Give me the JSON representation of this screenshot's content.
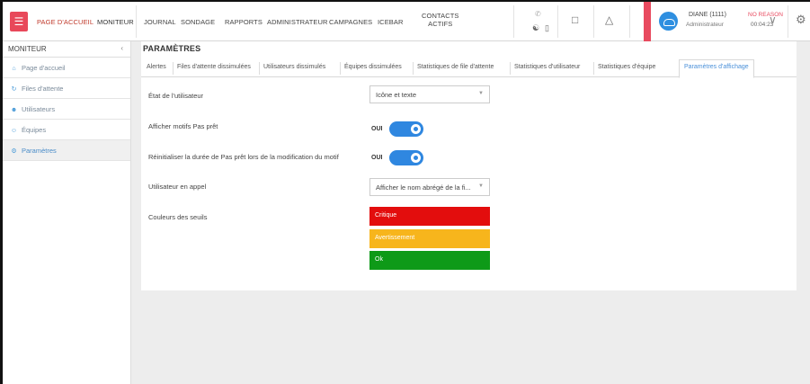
{
  "topbar": {
    "menu_icon": "hamburger-icon",
    "nav": [
      "PAGE D'ACCUEIL",
      "MONITEUR",
      "JOURNAL",
      "SONDAGE",
      "RAPPORTS",
      "ADMINISTRATEUR",
      "CAMPAGNES",
      "ICEBAR"
    ],
    "contacts_line1": "CONTACTS",
    "contacts_line2": "ACTIFS",
    "user": {
      "name": "DIANE (1111)",
      "role": "Administrateur",
      "reason": "NO REASON",
      "timer": "00:04:23"
    },
    "colors": {
      "accent": "#e84a5f",
      "avatar": "#2f8fe0"
    }
  },
  "sidebar": {
    "title": "MONITEUR",
    "items": [
      {
        "label": "Page d'accueil",
        "icon": "home-icon"
      },
      {
        "label": "Files d'attente",
        "icon": "queue-icon"
      },
      {
        "label": "Utilisateurs",
        "icon": "user-icon"
      },
      {
        "label": "Équipes",
        "icon": "team-icon"
      },
      {
        "label": "Paramètres",
        "icon": "gears-icon"
      }
    ]
  },
  "main": {
    "title": "PARAMÈTRES",
    "tabs": [
      "Alertes",
      "Files d'attente dissimulées",
      "Utilisateurs dissimulés",
      "Équipes dissimulées",
      "Statistiques de file d'attente",
      "Statistiques d'utilisateur",
      "Statistiques d'équipe",
      "Paramètres d'affichage"
    ],
    "settings": {
      "user_state_label": "État de l'utilisateur",
      "user_state_value": "Icône et texte",
      "show_not_ready_label": "Afficher motifs Pas prêt",
      "show_not_ready_value": "OUI",
      "reset_duration_label": "Réinitialiser la durée de Pas prêt lors de la modification du motif",
      "reset_duration_value": "OUI",
      "user_on_call_label": "Utilisateur en appel",
      "user_on_call_value": "Afficher le nom abrégé de la fi...",
      "threshold_colors_label": "Couleurs des seuils",
      "thresholds": [
        {
          "label": "Critique",
          "color": "#e30d0d"
        },
        {
          "label": "Avertissement",
          "color": "#f7b51c"
        },
        {
          "label": "Ok",
          "color": "#0e9a18"
        }
      ]
    }
  }
}
